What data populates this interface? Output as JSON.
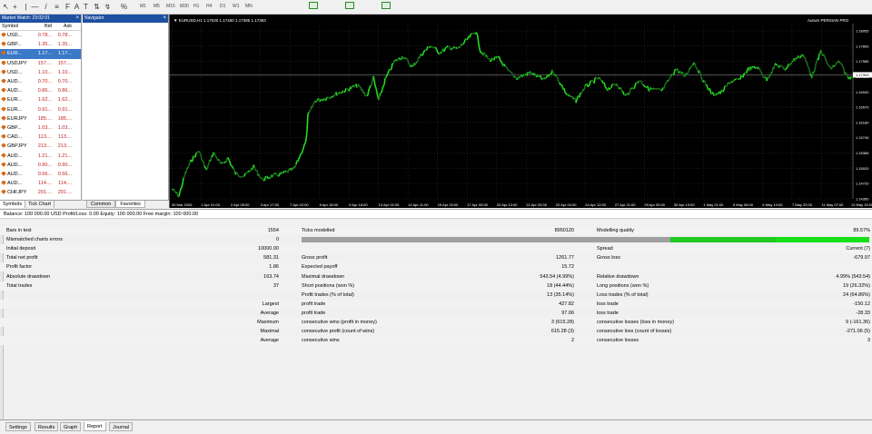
{
  "toolbar": {
    "periods": [
      "M1",
      "M5",
      "M15",
      "M30",
      "H1",
      "H4",
      "D1",
      "W1",
      "MN"
    ]
  },
  "market_watch": {
    "title": "Market Watch: 23:02:01",
    "headers": [
      "Symbol",
      "Bid",
      "Ask"
    ],
    "rows": [
      {
        "symbol": "USD...",
        "bid": "0.78...",
        "ask": "0.78...",
        "selected": false
      },
      {
        "symbol": "GBP...",
        "bid": "1.35...",
        "ask": "1.35...",
        "selected": false
      },
      {
        "symbol": "EUR...",
        "bid": "1.17...",
        "ask": "1.17...",
        "selected": true
      },
      {
        "symbol": "USDJPY",
        "bid": "157....",
        "ask": "157....",
        "selected": false
      },
      {
        "symbol": "USD...",
        "bid": "1.10...",
        "ask": "1.10...",
        "selected": false
      },
      {
        "symbol": "AUD...",
        "bid": "0.70...",
        "ask": "0.70...",
        "selected": false
      },
      {
        "symbol": "AUD...",
        "bid": "0.86...",
        "ask": "0.86...",
        "selected": false
      },
      {
        "symbol": "EUR...",
        "bid": "1.62...",
        "ask": "1.62...",
        "selected": false
      },
      {
        "symbol": "EUR...",
        "bid": "0.91...",
        "ask": "0.91...",
        "selected": false
      },
      {
        "symbol": "EURJPY",
        "bid": "185....",
        "ask": "185....",
        "selected": false
      },
      {
        "symbol": "GBP...",
        "bid": "1.03...",
        "ask": "1.03...",
        "selected": false
      },
      {
        "symbol": "CAD...",
        "bid": "113....",
        "ask": "113....",
        "selected": false
      },
      {
        "symbol": "GBPJPY",
        "bid": "213....",
        "ask": "213....",
        "selected": false
      },
      {
        "symbol": "AUD...",
        "bid": "1.21...",
        "ask": "1.21...",
        "selected": false
      },
      {
        "symbol": "AUD...",
        "bid": "0.90...",
        "ask": "0.90...",
        "selected": false
      },
      {
        "symbol": "AUD...",
        "bid": "0.56...",
        "ask": "0.56...",
        "selected": false
      },
      {
        "symbol": "AUD...",
        "bid": "114....",
        "ask": "114....",
        "selected": false
      },
      {
        "symbol": "CHFJPY",
        "bid": "201....",
        "ask": "201....",
        "selected": false
      }
    ],
    "tabs": [
      "Symbols",
      "Tick Chart"
    ]
  },
  "navigator": {
    "title": "Navigator",
    "tabs": [
      "Common",
      "Favorites"
    ]
  },
  "chart": {
    "header": "EURUSD,H1  1.17530 1.17450 1.17385 1.17393",
    "corner_label": "Aurum PERSIAN PRO",
    "price_labels": [
      "1.18055",
      "1.17800",
      "1.17585",
      "1.17393",
      "1.16940",
      "1.16570",
      "1.16180",
      "1.15745",
      "1.15385",
      "1.15020",
      "1.14720",
      "1.14350"
    ],
    "current_price": "1.17393",
    "time_labels": [
      "30 Mar 2026",
      "1 Apr 01:00",
      "2 Apr 05:00",
      "3 Apr 17:00",
      "7 Apr 02:00",
      "8 Apr 18:00",
      "9 Apr 18:00",
      "13 Apr 02:00",
      "14 Apr 11:00",
      "15 Apr 20:00",
      "17 Apr 05:00",
      "20 Apr 13:00",
      "21 Apr 20:00",
      "23 Apr 04:00",
      "24 Apr 12:00",
      "27 Apr 21:00",
      "29 Apr 05:00",
      "30 Apr 13:00",
      "1 May 21:00",
      "5 May 06:00",
      "6 May 14:00",
      "7 May 22:00",
      "11 May 07:00",
      "12 May 15:00"
    ],
    "colors": {
      "bright": "#22dd22",
      "dark": "#1a6a1a",
      "grid": "#3a3a3a",
      "text": "#ffffff"
    }
  },
  "status": {
    "text": "Balance: 100 000.00 USD  Profit/Loss: 0.00  Equity: 100 000.00  Free margin: 100 000.00"
  },
  "report": {
    "rows": [
      {
        "c1": "Bars in test",
        "v1": "1554",
        "c2": "Ticks modelled",
        "v2": "8950120",
        "c3": "Modelling quality",
        "v3": "89.57%"
      },
      {
        "c1": "Mismatched charts errors",
        "v1": "0",
        "c2": "",
        "v2": "",
        "c3": "",
        "v3": ""
      },
      {
        "c1": "Initial deposit",
        "v1": "10000.00",
        "c2": "",
        "v2": "",
        "c3": "Spread",
        "v3": "Current (7)"
      },
      {
        "c1": "Total net profit",
        "v1": "581.31",
        "c2": "Gross profit",
        "v2": "1261.77",
        "c3": "Gross loss",
        "v3": "-679.97"
      },
      {
        "c1": "Profit factor",
        "v1": "1.86",
        "c2": "Expected payoff",
        "v2": "15.72",
        "c3": "",
        "v3": ""
      },
      {
        "c1": "Absolute drawdown",
        "v1": "163.74",
        "c2": "Maximal drawdown",
        "v2": "543.54 (4.99%)",
        "c3": "Relative drawdown",
        "v3": "4.99% (543.54)"
      },
      {
        "c1": "Total trades",
        "v1": "37",
        "c2": "Short positions (won %)",
        "v2": "18 (44.44%)",
        "c3": "Long positions (won %)",
        "v3": "19 (26.32%)"
      },
      {
        "c1": "",
        "v1": "",
        "c2": "Profit trades (% of total)",
        "v2": "13 (35.14%)",
        "c3": "Loss trades (% of total)",
        "v3": "24 (64.86%)"
      },
      {
        "c1": "",
        "v1": "Largest",
        "c2": "profit trade",
        "v2": "427.82",
        "c3": "loss trade",
        "v3": "-150.12"
      },
      {
        "c1": "",
        "v1": "Average",
        "c2": "profit trade",
        "v2": "97.06",
        "c3": "loss trade",
        "v3": "-28.33"
      },
      {
        "c1": "",
        "v1": "Maximum",
        "c2": "consecutive wins (profit in money)",
        "v2": "3 (615.28)",
        "c3": "consecutive losses (loss in money)",
        "v3": "9 (-161.36)"
      },
      {
        "c1": "",
        "v1": "Maximal",
        "c2": "consecutive profit (count of wins)",
        "v2": "615.28 (3)",
        "c3": "consecutive loss (count of losses)",
        "v3": "-271.06 (5)"
      },
      {
        "c1": "",
        "v1": "Average",
        "c2": "consecutive wins",
        "v2": "2",
        "c3": "consecutive losses",
        "v3": "3"
      }
    ],
    "modelling_quality_pct": 89.57
  },
  "bottom_tabs": [
    "Settings",
    "Results",
    "Graph",
    "Report",
    "Journal"
  ],
  "active_bottom_tab": "Report"
}
